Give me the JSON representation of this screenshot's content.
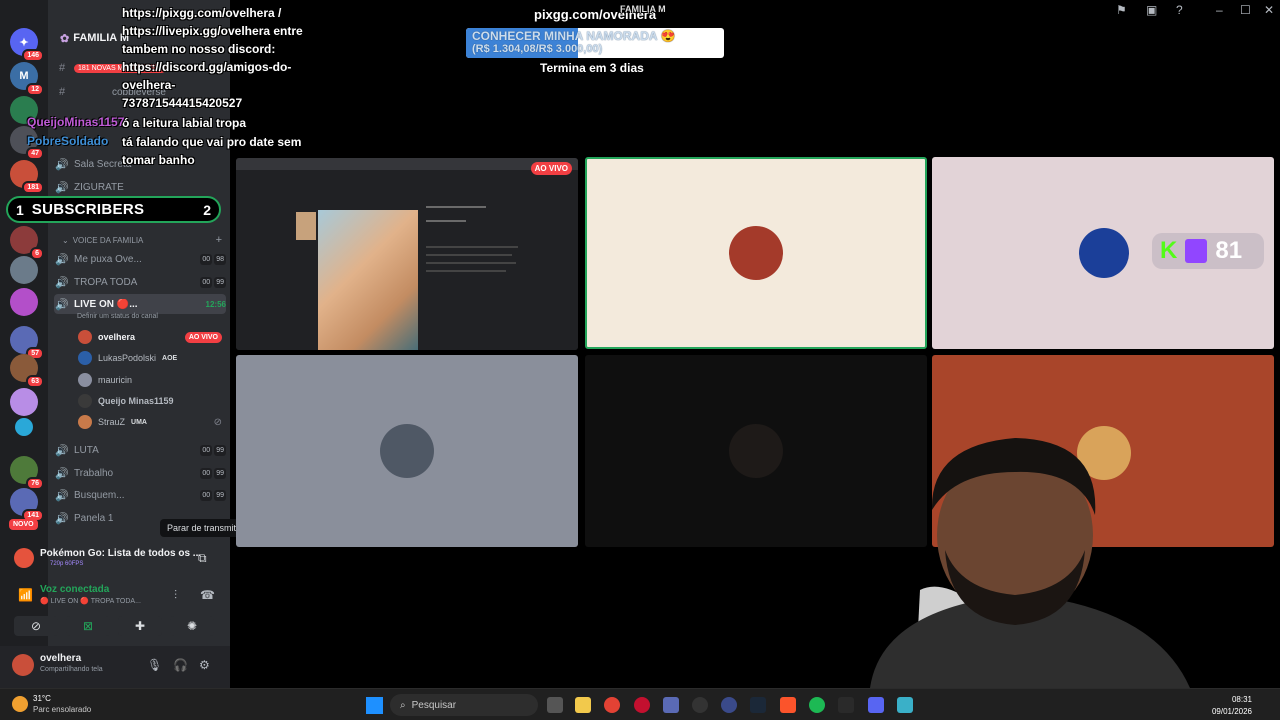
{
  "overlay": {
    "header": "pixgg.com/ovelhera",
    "top_logo": "FAMILIA M",
    "message_lines": [
      "https://pixgg.com/ovelhera /",
      "https://livepix.gg/ovelhera entre",
      "tambem no nosso discord:",
      "https://discord.gg/amigos-do-",
      "ovelhera-",
      "737871544415420527",
      "ó a leitura labial tropa",
      "tá falando que vai pro date sem",
      "tomar banho"
    ],
    "chat_users": [
      "QueijoMinas1157",
      "PobreSoldado"
    ],
    "subs": {
      "count": "1",
      "label": "SUBSCRIBERS",
      "goal": "2",
      "progress_fraction": 0.5
    },
    "goal": {
      "title": "CONHECER MINHA NAMORADA 😍",
      "amount": "(R$ 1.304,08/R$ 3.000,00)",
      "progress_fraction": 0.4347,
      "ends": "Termina em 3 dias"
    },
    "viewer_count": "81"
  },
  "server_rail": {
    "badges": [
      "146",
      "12",
      "47",
      "181",
      "6",
      "57",
      "63",
      "76",
      "141"
    ],
    "new_label": "NOVO",
    "colors": [
      "#5865f2",
      "#3b6ea5",
      "#2a7d4f",
      "#c94f3a",
      "#8c3b3b",
      "#6b7b8a",
      "#b34fc9",
      "#4e5058",
      "#8a5a3a",
      "#b88de6",
      "#2aa8d8",
      "#4e7a3a",
      "#5a6ab5",
      "#2aa85a"
    ]
  },
  "sidebar": {
    "server_name": "FAMILIA M",
    "text_channels": [
      {
        "icon": "#",
        "label": "181 NOVAS MENSAGENS"
      },
      {
        "icon": "#",
        "label": "cobbleverse"
      }
    ],
    "voice_channels_top": [
      {
        "label": "Sala Secreta"
      },
      {
        "label": "ZIGURATE"
      }
    ],
    "voice_category": "VOICE DA FAMILIA",
    "voice_channels": [
      {
        "label": "Me puxa Ove...",
        "c1": "00",
        "c2": "98"
      },
      {
        "label": "TROPA TODA",
        "c1": "00",
        "c2": "99"
      },
      {
        "label": "LIVE ON 🔴...",
        "time": "12:56",
        "active": true
      }
    ],
    "channel_status": "Definir um status do canal",
    "voice_users": [
      {
        "name": "ovelhera",
        "live": "AO VIVO",
        "color": "#c94f3a"
      },
      {
        "name": "LukasPodolski",
        "tag": "AOE",
        "color": "#2b5fa8"
      },
      {
        "name": "mauricin",
        "color": "#8a8fa0"
      },
      {
        "name": "Queijo Minas1159",
        "color": "#3a3a3a"
      },
      {
        "name": "StrauZ",
        "tag": "UMA",
        "color": "#c87a4a"
      }
    ],
    "voice_channels_bottom": [
      {
        "label": "LUTA",
        "c1": "00",
        "c2": "99"
      },
      {
        "label": "Trabalho",
        "c1": "00",
        "c2": "99"
      },
      {
        "label": "Busquem...",
        "c1": "00",
        "c2": "99"
      },
      {
        "label": "Panela 1"
      }
    ],
    "tooltip": "Parar de transmitir",
    "stream": {
      "title": "Pokémon Go: Lista de todos os ...",
      "quality": "720p 60FPS"
    },
    "voice": {
      "title": "Voz conectada",
      "subtitle": "🔴 LIVE ON 🔴 TROPA TODA..."
    },
    "user": {
      "name": "ovelhera",
      "status": "Compartilhando tela"
    }
  },
  "grid": {
    "live_badge": "AO VIVO",
    "tile_colors": [
      "#202124",
      "#f3eadc",
      "#e2d3d7",
      "#8a8f9b",
      "#0f0f0f",
      "#a9452a"
    ]
  },
  "taskbar": {
    "temperature": "31°C",
    "weather": "Parc ensolarado",
    "search_placeholder": "Pesquisar",
    "time": "08:31",
    "date": "09/01/2026"
  }
}
